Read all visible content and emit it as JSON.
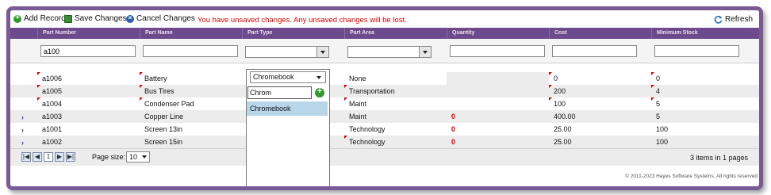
{
  "toolbar": {
    "add_record": "Add Record",
    "save_changes": "Save Changes",
    "cancel_changes": "Cancel Changes",
    "warning": "You have unsaved changes. Any unsaved changes will be lost.",
    "refresh": "Refresh"
  },
  "columns": [
    "Part Number",
    "Part Name",
    "Part Type",
    "Part Area",
    "Quantity",
    "Cost",
    "Minimum Stock"
  ],
  "filters": {
    "part_number": "a100",
    "part_name": "",
    "part_type": "",
    "part_area": "",
    "quantity": "",
    "cost": "",
    "minimum_stock": ""
  },
  "rows": [
    {
      "part_number": "a1006",
      "part_name": "Battery",
      "part_type": "",
      "part_area": "None",
      "quantity": "",
      "cost": "0",
      "minimum_stock": "0",
      "expander": ""
    },
    {
      "part_number": "a1005",
      "part_name": "Bus Tires",
      "part_type": "",
      "part_area": "Transportation",
      "quantity": "",
      "cost": "200",
      "minimum_stock": "4",
      "expander": ""
    },
    {
      "part_number": "a1004",
      "part_name": "Condenser Pad",
      "part_type": "",
      "part_area": "Maint",
      "quantity": "",
      "cost": "100",
      "minimum_stock": "5",
      "expander": ""
    },
    {
      "part_number": "a1003",
      "part_name": "Copper Line",
      "part_type": "",
      "part_area": "Maint",
      "quantity": "0",
      "cost": "400.00",
      "minimum_stock": "5",
      "expander": "›"
    },
    {
      "part_number": "a1001",
      "part_name": "Screen 13in",
      "part_type": "",
      "part_area": "Technology",
      "quantity": "0",
      "cost": "25.00",
      "minimum_stock": "100",
      "expander": "›"
    },
    {
      "part_number": "a1002",
      "part_name": "Screen 15in",
      "part_type": "",
      "part_area": "Technology",
      "quantity": "0",
      "cost": "25.00",
      "minimum_stock": "100",
      "expander": "›"
    }
  ],
  "dropdown": {
    "selected": "Chromebook",
    "search_text": "Chrom",
    "options": [
      "Chromebook"
    ]
  },
  "pager": {
    "first": "|◀",
    "prev": "◀",
    "page": "1",
    "next": "▶",
    "last": "▶|",
    "page_size_label": "Page size:",
    "page_size": "10",
    "items_info": "3 items in 1 pages"
  },
  "copyright": "© 2011-2023 Hayes Software Systems. All rights reserved",
  "colors": {
    "header_bg": "#6d4a8c",
    "frame": "#7a5a95",
    "warning": "#d40000",
    "dropdown_highlight": "#b8d6ea"
  },
  "icons": {
    "add": "plus-circle-icon",
    "save": "floppy-disk-icon",
    "cancel": "cancel-circle-icon",
    "refresh": "refresh-icon"
  }
}
